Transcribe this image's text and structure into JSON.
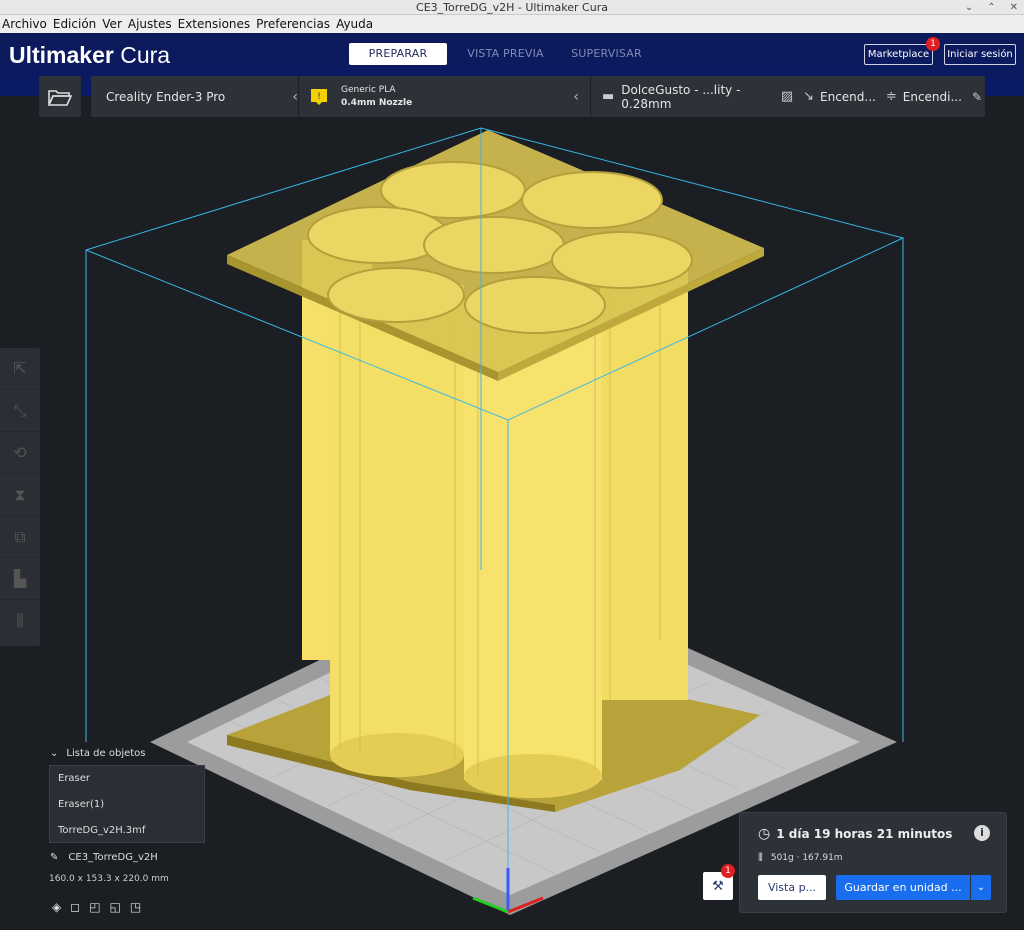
{
  "window": {
    "title": "CE3_TorreDG_v2H - Ultimaker Cura"
  },
  "menu": [
    "Archivo",
    "Edición",
    "Ver",
    "Ajustes",
    "Extensiones",
    "Preferencias",
    "Ayuda"
  ],
  "header": {
    "logo_bold": "Ultimaker",
    "logo_light": "Cura",
    "tabs": [
      "PREPARAR",
      "VISTA PREVIA",
      "SUPERVISAR"
    ],
    "active_tab": "PREPARAR",
    "marketplace_label": "Marketplace",
    "marketplace_badge": "1",
    "signin_label": "Iniciar sesión"
  },
  "setup": {
    "printer": "Creality Ender-3 Pro",
    "material_name": "Generic PLA",
    "nozzle": "0.4mm Nozzle",
    "profile": "DolceGusto - ...lity - 0.28mm",
    "support": "Encend...",
    "adhesion": "Encendi..."
  },
  "tools": [
    "move-icon",
    "scale-icon",
    "rotate-icon",
    "mirror-icon",
    "per-model-settings-icon",
    "support-blocker-icon",
    "tab-anti-warping-icon"
  ],
  "object_list": {
    "header": "Lista de objetos",
    "items": [
      "Eraser",
      "Eraser(1)",
      "TorreDG_v2H.3mf"
    ]
  },
  "project": {
    "name": "CE3_TorreDG_v2H",
    "dimensions": "160.0 x 153.3 x 220.0 mm"
  },
  "print": {
    "time": "1 día 19 horas 21 minutos",
    "material": "501g · 167.91m",
    "preview_label": "Vista p...",
    "save_label": "Guardar en unidad ...",
    "prefs_badge": "1"
  },
  "colors": {
    "header_bg": "#0a1a66",
    "accent_blue": "#196ef0",
    "model_yellow": "#f5e26a",
    "build_volume_line": "#38b8e8"
  }
}
